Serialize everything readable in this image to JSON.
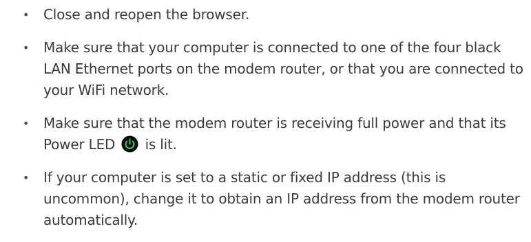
{
  "bullets": [
    {
      "text": "Close and reopen the browser."
    },
    {
      "text": "Make sure that your computer is connected to one of the four black LAN Ethernet ports on the modem router, or that you are connected to your WiFi network."
    },
    {
      "text_before": "Make sure that the modem router is receiving full power and that its Power LED",
      "icon": "power-led-icon",
      "text_after": "is lit."
    },
    {
      "text": "If your computer is set to a static or fixed IP address (this is uncommon), change it to obtain an IP address from the modem router automatically."
    }
  ],
  "bullet_glyph": "•",
  "colors": {
    "text": "#3a3a3a",
    "led_ring": "#0a0a0a",
    "led_green": "#39b54a"
  }
}
